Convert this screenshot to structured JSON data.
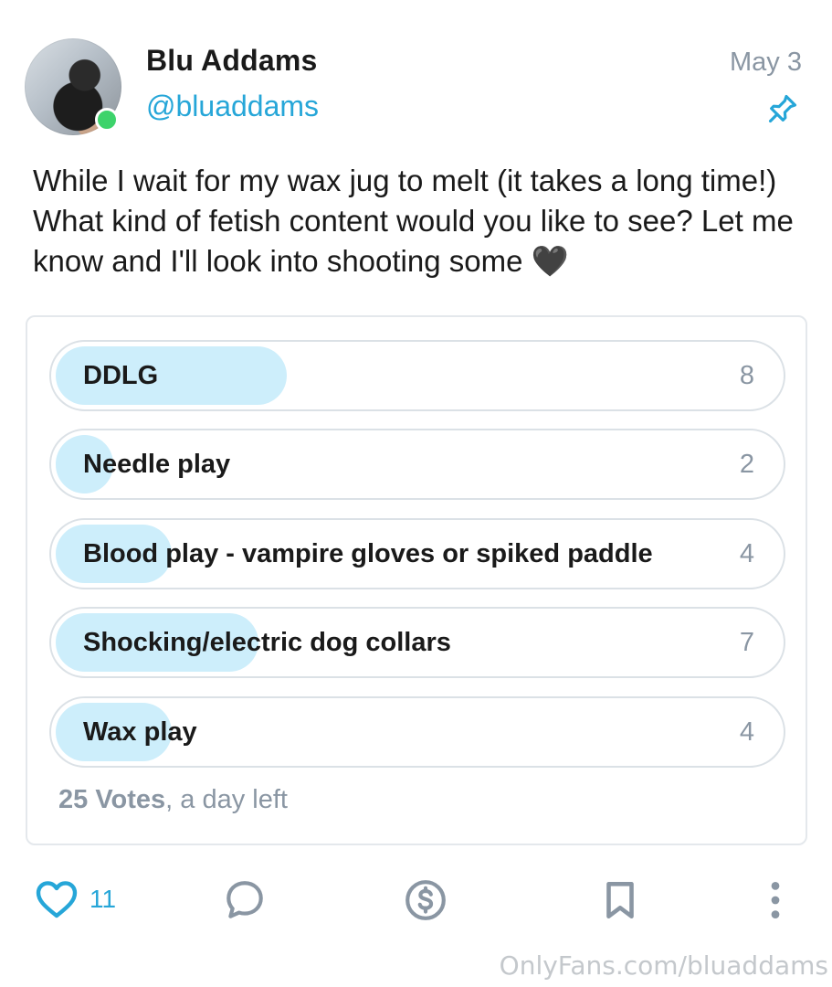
{
  "author": {
    "display_name": "Blu Addams",
    "handle": "@bluaddams",
    "online": true
  },
  "post": {
    "date": "May 3",
    "pinned": true,
    "text": "While I wait for my wax jug to melt (it takes a long time!) What kind of fetish content would you like to see? Let me know and I'll look into shooting some 🖤"
  },
  "poll": {
    "options": [
      {
        "label": "DDLG",
        "count": "8",
        "fraction": 0.32
      },
      {
        "label": "Needle play",
        "count": "2",
        "fraction": 0.08
      },
      {
        "label": "Blood play - vampire gloves or spiked paddle",
        "count": "4",
        "fraction": 0.16
      },
      {
        "label": "Shocking/electric dog collars",
        "count": "7",
        "fraction": 0.28
      },
      {
        "label": "Wax play",
        "count": "4",
        "fraction": 0.16
      }
    ],
    "votes": "25 Votes",
    "time_left": ", a day left"
  },
  "actions": {
    "likes": "11",
    "icons": [
      "heart-icon",
      "comment-icon",
      "tip-dollar-icon",
      "bookmark-icon",
      "more-vertical-icon"
    ]
  },
  "watermark": "OnlyFans.com/bluaddams",
  "colors": {
    "accent": "#26a6d8",
    "poll_fill": "#cdeefb",
    "muted": "#8a96a3",
    "online": "#3dd36b"
  }
}
